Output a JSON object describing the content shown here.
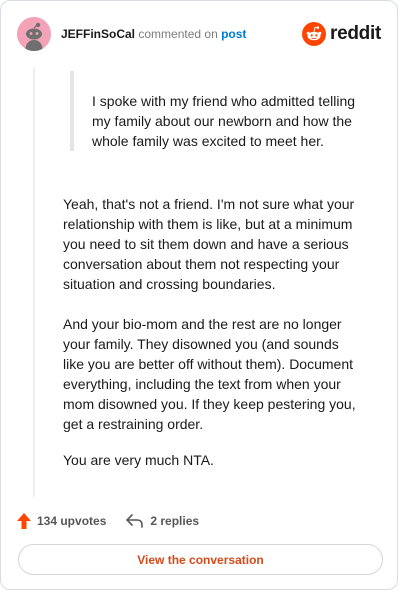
{
  "header": {
    "username": "JEFFinSoCal",
    "action_text": "commented on",
    "post_link": "post",
    "logo_text": "reddit"
  },
  "quote": {
    "text": "I spoke with my friend who admitted telling my family about our newborn and how the whole family was excited to meet her."
  },
  "comment": {
    "paragraphs": [
      "Yeah, that's not a friend. I'm not sure what your relationship with them is like, but at a minimum you need to sit them down and have a serious conversation about them not respecting your situation and crossing boundaries.",
      "And your bio-mom and the rest are no longer your family. They disowned you (and sounds like you are better off without them). Document everything, including the text from when your mom disowned you. If they keep pestering you, get a restraining order.",
      "You are very much NTA."
    ]
  },
  "actions": {
    "upvotes": "134 upvotes",
    "replies": "2 replies"
  },
  "cta": {
    "label": "View the conversation"
  },
  "colors": {
    "brand": "#ff4500",
    "link": "#0079d3",
    "cta_text": "#d64a1a"
  },
  "icons": [
    "avatar-icon",
    "reddit-logo-icon",
    "upvote-arrow-icon",
    "reply-icon"
  ]
}
